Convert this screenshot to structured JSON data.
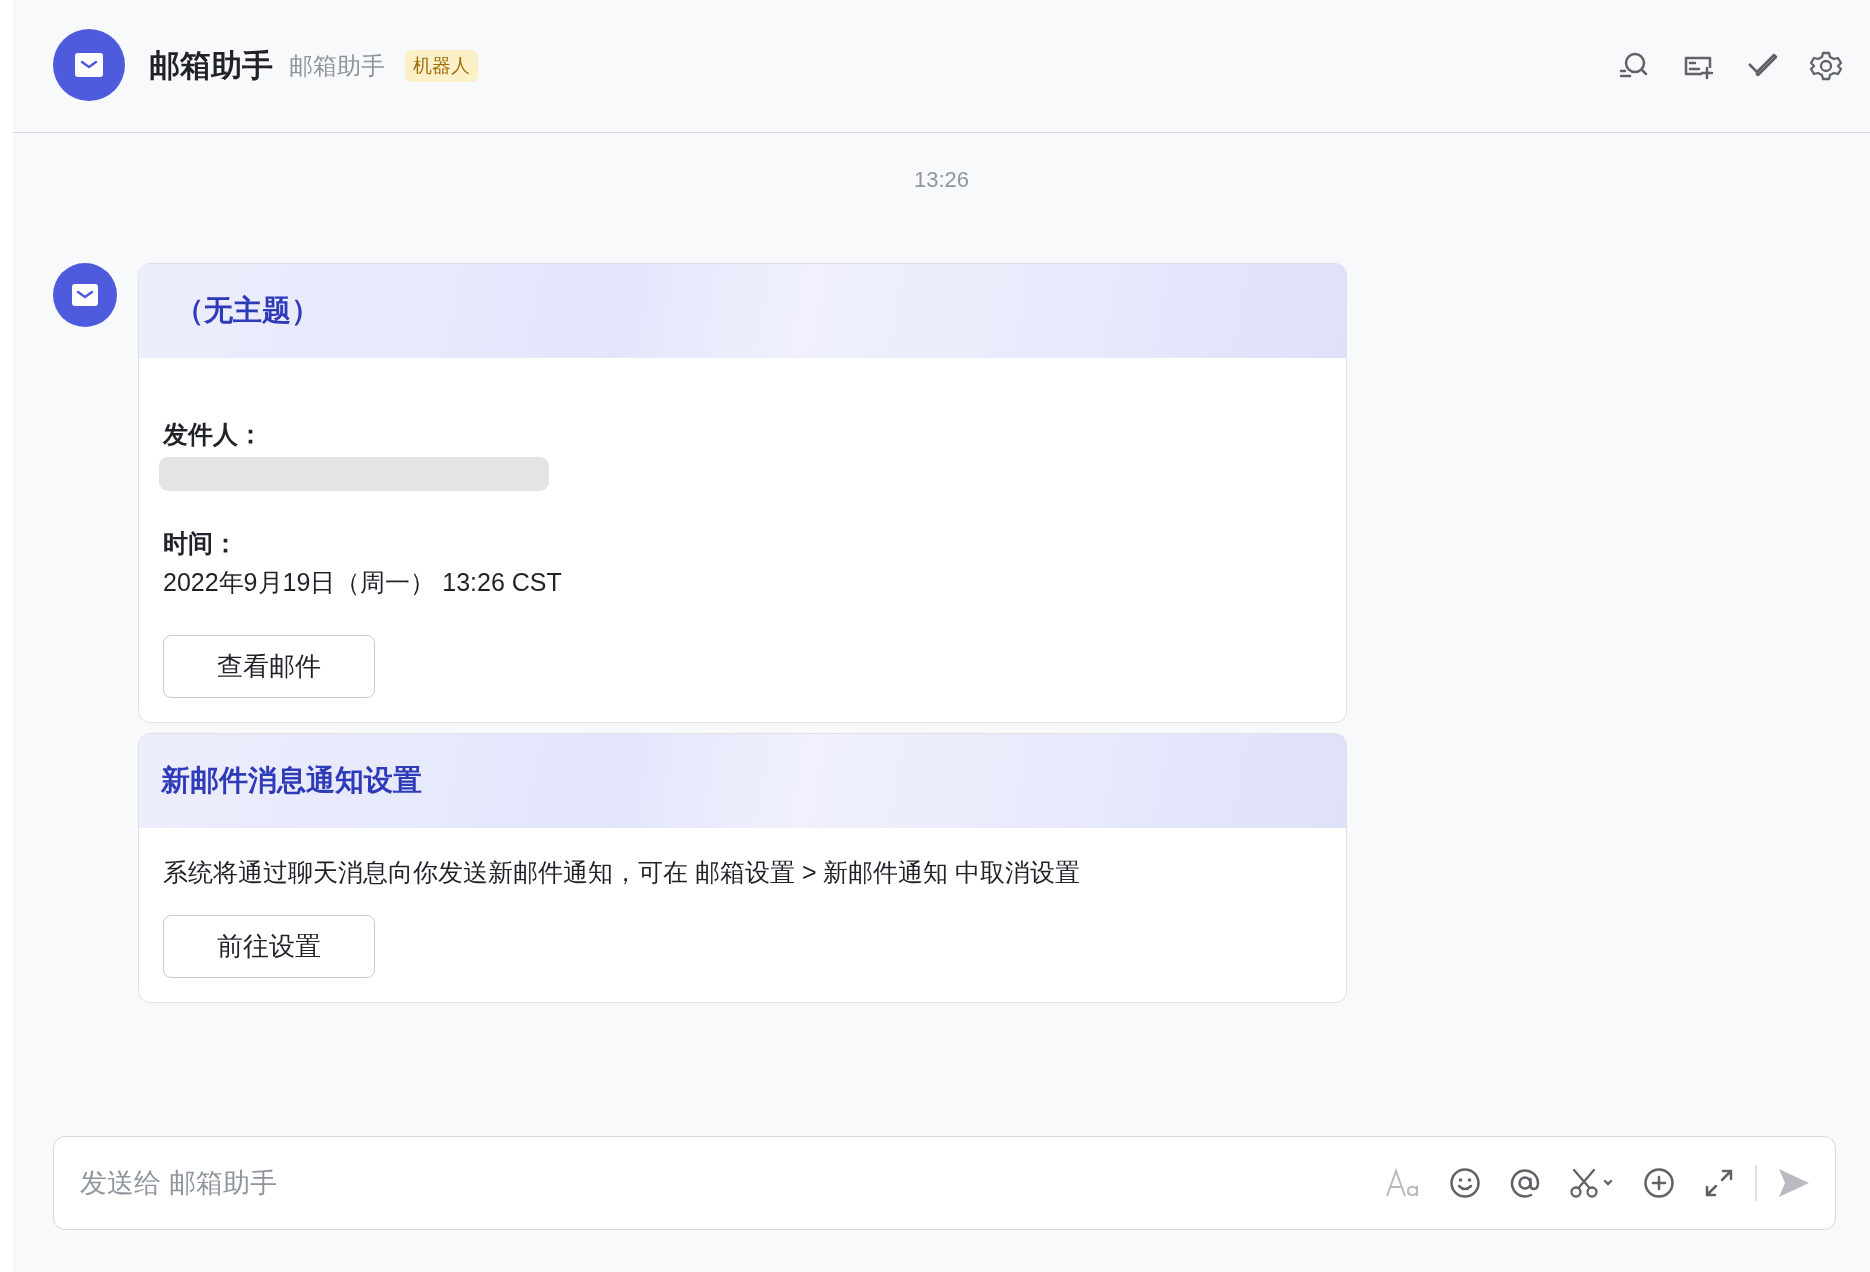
{
  "header": {
    "title": "邮箱助手",
    "subtitle": "邮箱助手",
    "badge": "机器人"
  },
  "timestamp": "13:26",
  "cards": [
    {
      "kind": "mail",
      "title": "（无主题）",
      "fields": [
        {
          "label": "发件人：",
          "redacted": true
        },
        {
          "label": "时间：",
          "value": "2022年9月19日（周一） 13:26 CST",
          "redacted": false
        }
      ],
      "button": "查看邮件"
    },
    {
      "kind": "notice",
      "title": "新邮件消息通知设置",
      "body": "系统将通过聊天消息向你发送新邮件通知，可在 邮箱设置 > 新邮件通知 中取消设置",
      "button": "前往设置"
    }
  ],
  "composer": {
    "placeholder": "发送给 邮箱助手"
  }
}
